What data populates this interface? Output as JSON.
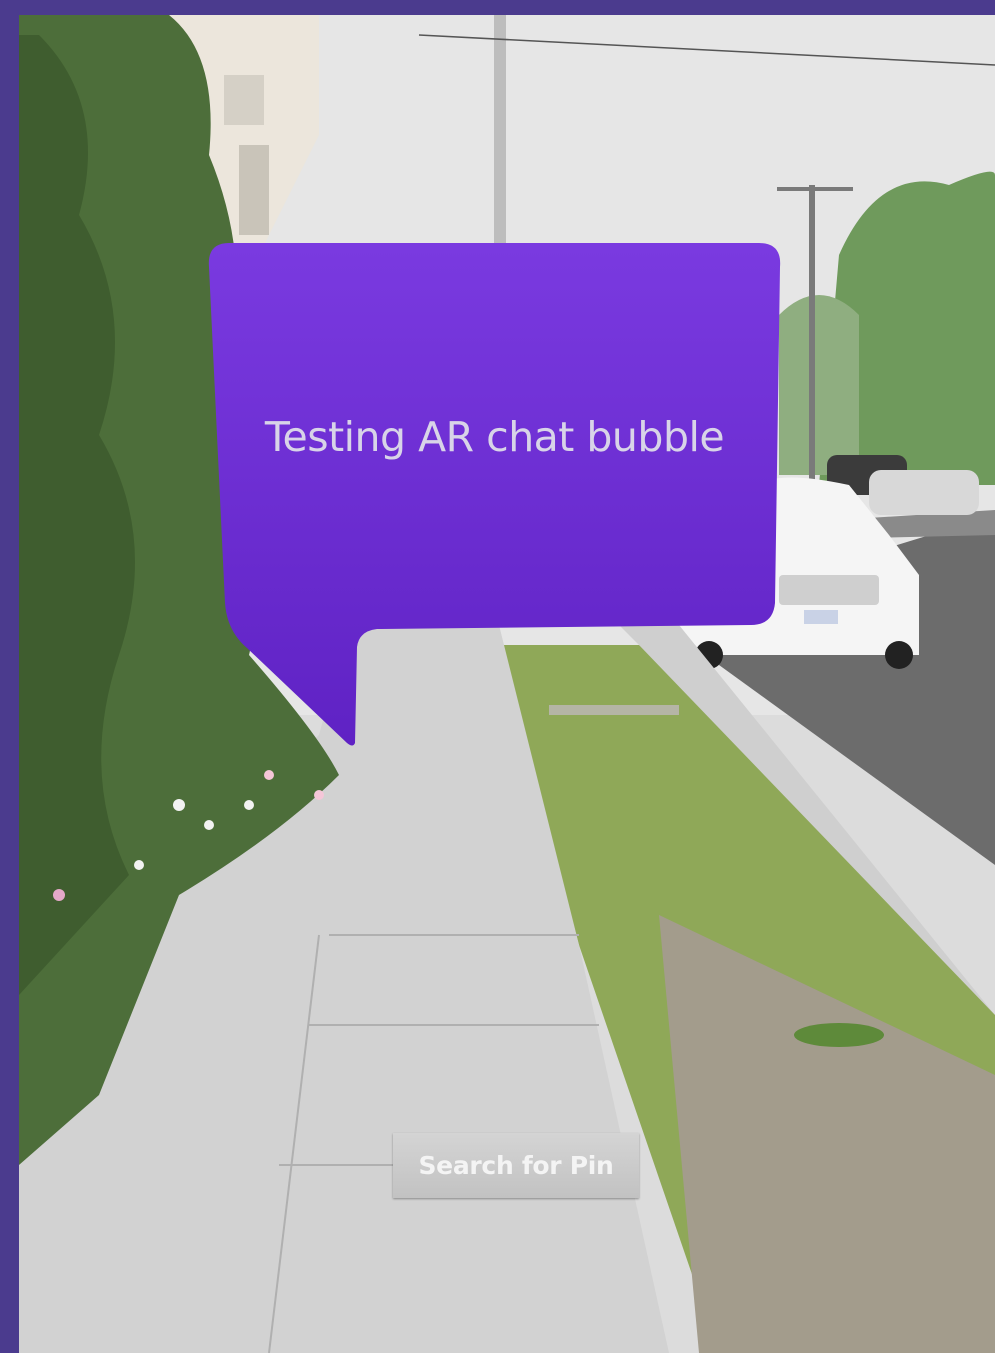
{
  "ar_view": {
    "bubble": {
      "text": "Testing AR chat bubble",
      "color": "#6a2ed0"
    },
    "search_button": {
      "label": "Search for Pin"
    }
  },
  "colors": {
    "frame": "#4b3b8e",
    "button": "#c8c8c8"
  }
}
